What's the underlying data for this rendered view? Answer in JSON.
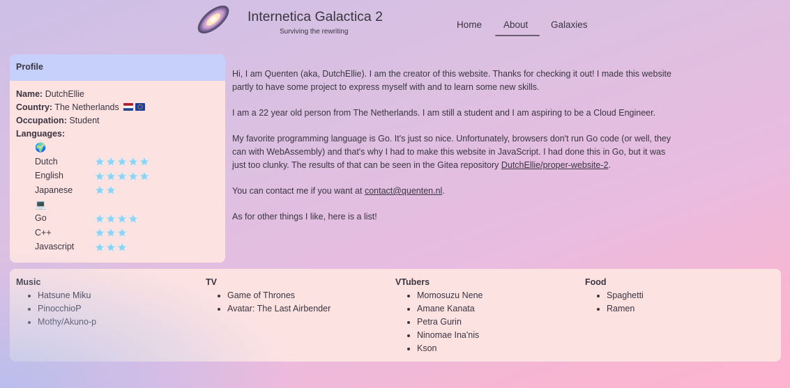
{
  "header": {
    "title": "Internetica Galactica 2",
    "subtitle": "Surviving the rewriting",
    "nav": [
      "Home",
      "About",
      "Galaxies"
    ],
    "active_nav": "About"
  },
  "profile": {
    "heading": "Profile",
    "fields": [
      {
        "label": "Name:",
        "value": "DutchEllie"
      },
      {
        "label": "Country:",
        "value": "The Netherlands"
      },
      {
        "label": "Occupation:",
        "value": "Student"
      },
      {
        "label": "Languages:",
        "value": ""
      }
    ],
    "spoken_icon": "🌍",
    "spoken": [
      {
        "name": "Dutch",
        "stars": 5
      },
      {
        "name": "English",
        "stars": 5
      },
      {
        "name": "Japanese",
        "stars": 2
      }
    ],
    "programming_icon": "💻",
    "programming": [
      {
        "name": "Go",
        "stars": 4
      },
      {
        "name": "C++",
        "stars": 3
      },
      {
        "name": "Javascript",
        "stars": 3
      }
    ]
  },
  "about": {
    "p1": "Hi, I am Quenten (aka, DutchEllie). I am the creator of this website. Thanks for checking it out! I made this website partly to have some project to express myself with and to learn some new skills.",
    "p2": "I am a 22 year old person from The Netherlands. I am still a student and I am aspiring to be a Cloud Engineer.",
    "p3_before": "My favorite programming language is Go. It's just so nice. Unfortunately, browsers don't run Go code (or well, they can with WebAssembly) and that's why I had to make this website in JavaScript. I had done this in Go, but it was just too clunky. The results of that can be seen in the Gitea repository ",
    "p3_link": "DutchEllie/proper-website-2",
    "p3_after": ".",
    "p4_before": "You can contact me if you want at ",
    "p4_link": "contact@quenten.nl",
    "p4_after": ".",
    "p5": "As for other things I like, here is a list!"
  },
  "likes": [
    {
      "title": "Music",
      "items": [
        "Hatsune Miku",
        "PinocchioP",
        "Mothy/Akuno-p"
      ]
    },
    {
      "title": "TV",
      "items": [
        "Game of Thrones",
        "Avatar: The Last Airbender"
      ]
    },
    {
      "title": "VTubers",
      "items": [
        "Momosuzu Nene",
        "Amane Kanata",
        "Petra Gurin",
        "Ninomae Ina'nis",
        "Kson"
      ]
    },
    {
      "title": "Food",
      "items": [
        "Spaghetti",
        "Ramen"
      ]
    }
  ],
  "colors": {
    "card": "#fde2e2",
    "card_header": "#c7d0fb",
    "text": "#3a3440",
    "star": "#8fd3f4"
  }
}
